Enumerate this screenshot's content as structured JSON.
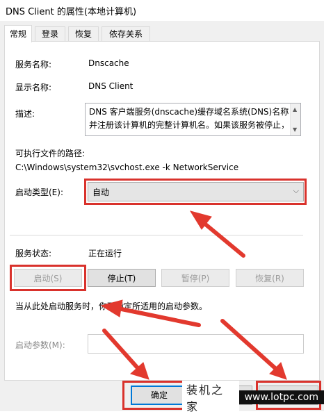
{
  "window": {
    "title": "DNS Client 的属性(本地计算机)"
  },
  "tabs": [
    {
      "label": "常规",
      "active": true
    },
    {
      "label": "登录",
      "active": false
    },
    {
      "label": "恢复",
      "active": false
    },
    {
      "label": "依存关系",
      "active": false
    }
  ],
  "general": {
    "service_name_label": "服务名称:",
    "service_name_value": "Dnscache",
    "display_name_label": "显示名称:",
    "display_name_value": "DNS Client",
    "description_label": "描述:",
    "description_line1": "DNS 客户端服务(dnscache)缓存域名系统(DNS)名称",
    "description_line2": "并注册该计算机的完整计算机名。如果该服务被停止，",
    "exe_path_label": "可执行文件的路径:",
    "exe_path_value": "C:\\Windows\\system32\\svchost.exe -k NetworkService",
    "startup_type_label": "启动类型(E):",
    "startup_type_value": "自动",
    "status_label": "服务状态:",
    "status_value": "正在运行",
    "buttons": {
      "start": "启动(S)",
      "stop": "停止(T)",
      "pause": "暂停(P)",
      "resume": "恢复(R)"
    },
    "hint": "当从此处启动服务时，你可指定所适用的启动参数。",
    "start_params_label": "启动参数(M):",
    "start_params_value": ""
  },
  "footer": {
    "ok_label": "确定"
  },
  "watermark": {
    "left": "装机之家",
    "right": "www.lotpc.com"
  },
  "colors": {
    "highlight": "#d9322c",
    "accent": "#0078d7"
  }
}
